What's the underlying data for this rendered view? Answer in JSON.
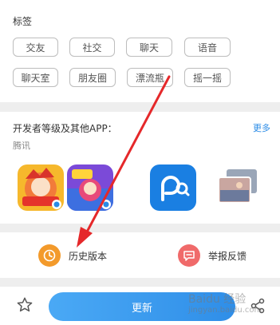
{
  "tags": {
    "title": "标签",
    "items": [
      "交友",
      "社交",
      "聊天",
      "语音",
      "聊天室",
      "朋友圈",
      "漂流瓶",
      "摇一摇"
    ]
  },
  "developer": {
    "title": "开发者等级及其他APP：",
    "more": "更多",
    "name": "腾讯",
    "apps": [
      {
        "icon": "game-hero-icon"
      },
      {
        "icon": "racing-game-icon"
      },
      {
        "icon": "blue-p-app-icon"
      },
      {
        "icon": "photo-gallery-icon"
      }
    ]
  },
  "actions": {
    "history_label": "历史版本",
    "report_label": "举报反馈"
  },
  "bottom": {
    "update_label": "更新"
  },
  "colors": {
    "accent_blue": "#2f8ee8",
    "history_orange": "#f39a2b",
    "report_red": "#f06a6a",
    "annotation_red": "#e5282a"
  },
  "watermark": {
    "line1": "Baidu 经验",
    "line2": "jingyan.baidu.com"
  }
}
